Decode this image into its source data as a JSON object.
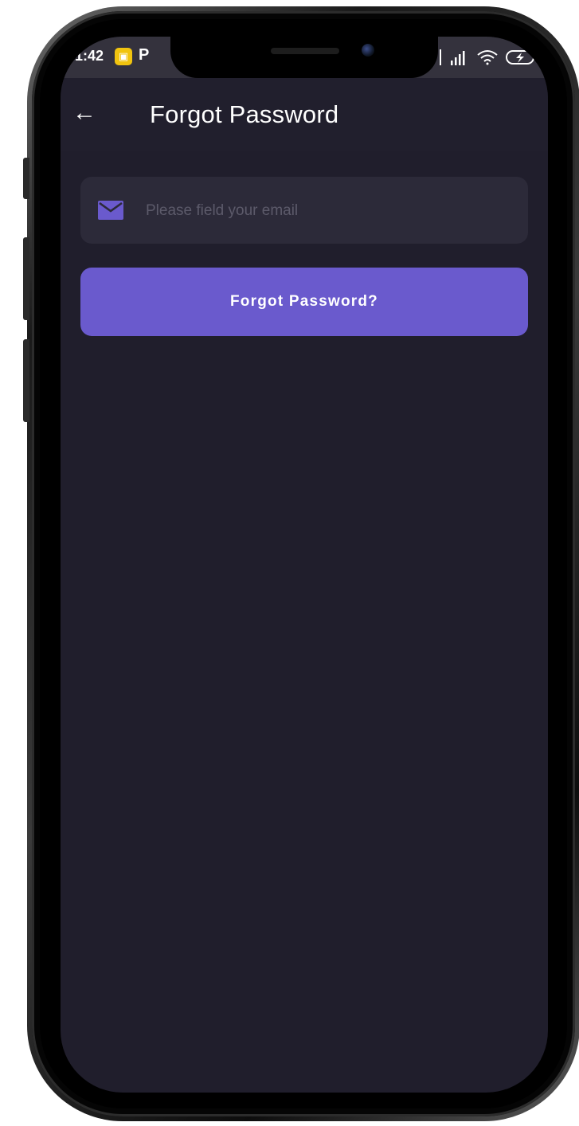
{
  "statusbar": {
    "time": "1:42",
    "app_badge": "▣",
    "p_icon": "P",
    "icons": [
      "signal-icon",
      "wifi-icon",
      "battery-charging-icon"
    ]
  },
  "appbar": {
    "back_icon": "←",
    "title": "Forgot Password"
  },
  "form": {
    "email_icon": "mail-icon",
    "email_placeholder": "Please field your email",
    "email_value": "",
    "submit_label": "Forgot Password?"
  },
  "zoom": {
    "in_label": "+",
    "out_label": "−"
  },
  "colors": {
    "background": "#201e2c",
    "field": "#2c2a39",
    "accent": "#6a5acd",
    "zoom": "#67d4e6"
  }
}
